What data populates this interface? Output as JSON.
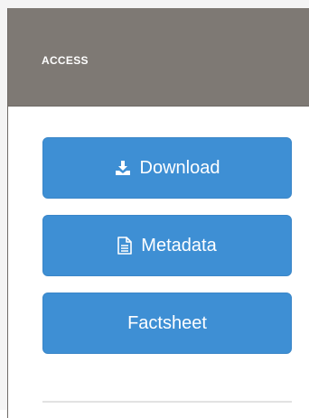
{
  "panel": {
    "title": "ACCESS"
  },
  "buttons": {
    "download": {
      "label": "Download",
      "icon": "download-icon"
    },
    "metadata": {
      "label": "Metadata",
      "icon": "document-icon"
    },
    "factsheet": {
      "label": "Factsheet"
    }
  },
  "colors": {
    "header_bg": "#7e7974",
    "button_bg": "#3e8fd4",
    "button_text": "#ffffff"
  }
}
